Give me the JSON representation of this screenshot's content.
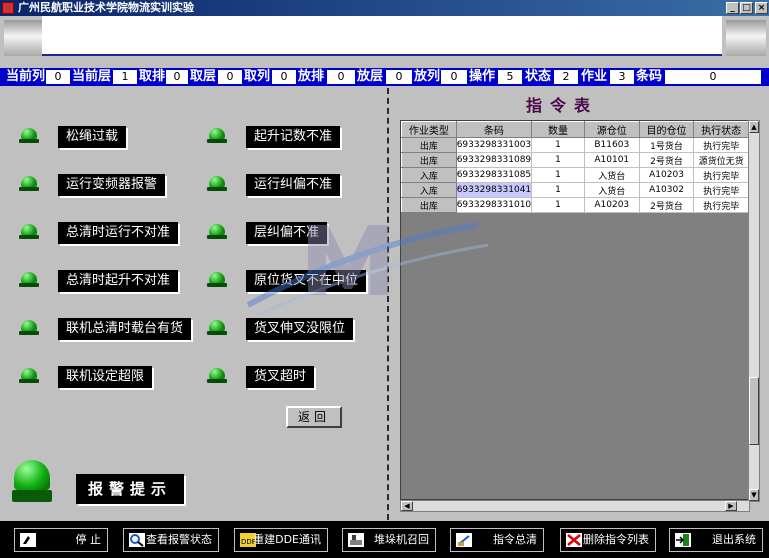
{
  "window": {
    "title": "广州民航职业技术学院物流实训实验"
  },
  "status": {
    "items": [
      {
        "label": "当前列",
        "value": "0"
      },
      {
        "label": "当前层",
        "value": "1"
      },
      {
        "label": "取排",
        "value": "0"
      },
      {
        "label": "取层",
        "value": "0"
      },
      {
        "label": "取列",
        "value": "0"
      },
      {
        "label": "放排",
        "value": "0"
      },
      {
        "label": "放层",
        "value": "0"
      },
      {
        "label": "放列",
        "value": "0"
      },
      {
        "label": "操作",
        "value": "5"
      },
      {
        "label": "状态",
        "value": "2"
      },
      {
        "label": "作业",
        "value": "3"
      },
      {
        "label": "条码",
        "value": "0"
      }
    ]
  },
  "alarms": {
    "left": [
      "松绳过载",
      "运行变频器报警",
      "总清时运行不对准",
      "总清时起升不对准",
      "联机总清时载台有货",
      "联机设定超限"
    ],
    "right": [
      "起升记数不准",
      "运行纠偏不准",
      "层纠偏不准",
      "原位货叉不在中位",
      "货叉伸叉没限位",
      "货叉超时"
    ]
  },
  "buttons": {
    "return": "返回"
  },
  "alarm_hint": "报警提示",
  "cmd_table": {
    "title": "指令表",
    "columns": [
      "作业类型",
      "条码",
      "数量",
      "源仓位",
      "目的仓位",
      "执行状态"
    ],
    "rows": [
      [
        "出库",
        "6933298331003",
        "1",
        "B11603",
        "1号货台",
        "执行完毕"
      ],
      [
        "出库",
        "6933298331089",
        "1",
        "A10101",
        "2号货台",
        "源货位无货"
      ],
      [
        "入库",
        "6933298331085",
        "1",
        "入货台",
        "A10203",
        "执行完毕"
      ],
      [
        "入库",
        "6933298331041",
        "1",
        "入货台",
        "A10302",
        "执行完毕"
      ],
      [
        "出库",
        "6933298331010",
        "1",
        "A10203",
        "2号货台",
        "执行完毕"
      ]
    ]
  },
  "toolbar": {
    "items": [
      {
        "label": "停  止",
        "icon": "hand-pointer-icon"
      },
      {
        "label": "查看报警状态",
        "icon": "magnifier-icon"
      },
      {
        "label": "重建DDE通讯",
        "icon": "dde-icon"
      },
      {
        "label": "堆垛机召回",
        "icon": "stacker-icon"
      },
      {
        "label": "指令总清",
        "icon": "clear-icon"
      },
      {
        "label": "删除指令列表",
        "icon": "delete-x-icon"
      },
      {
        "label": "退出系统",
        "icon": "exit-door-icon"
      }
    ]
  }
}
